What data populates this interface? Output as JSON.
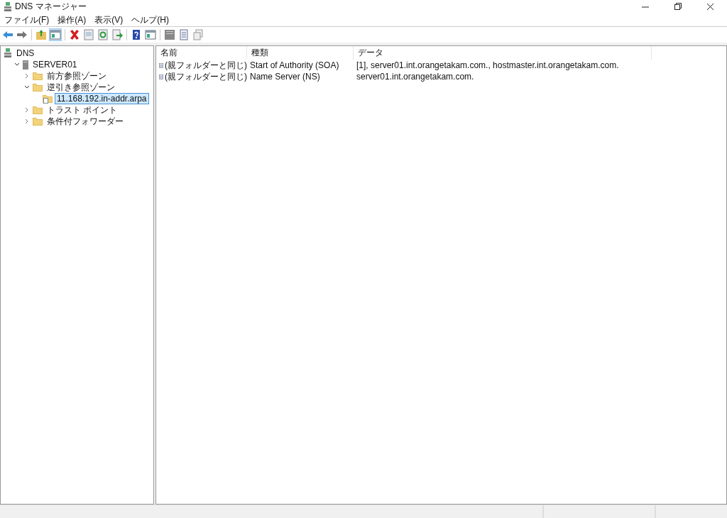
{
  "window": {
    "title": "DNS マネージャー"
  },
  "menu": [
    "ファイル(F)",
    "操作(A)",
    "表示(V)",
    "ヘルプ(H)"
  ],
  "toolbar": [
    [
      {
        "kind": "back",
        "pressed": false
      },
      {
        "kind": "forward",
        "pressed": false
      }
    ],
    [
      {
        "kind": "folder-up",
        "pressed": false
      },
      {
        "kind": "pane",
        "pressed": true
      }
    ],
    [
      {
        "kind": "delete",
        "pressed": false
      },
      {
        "kind": "properties",
        "pressed": false
      },
      {
        "kind": "refresh",
        "pressed": false
      },
      {
        "kind": "export",
        "pressed": false
      }
    ],
    [
      {
        "kind": "help",
        "pressed": false
      },
      {
        "kind": "pane",
        "pressed": false
      }
    ],
    [
      {
        "kind": "server",
        "pressed": false
      },
      {
        "kind": "list",
        "pressed": false
      },
      {
        "kind": "copy",
        "pressed": false
      }
    ]
  ],
  "tree": [
    {
      "label": "DNS",
      "kind": "dns",
      "selected": false,
      "children": [
        {
          "label": "SERVER01",
          "kind": "server",
          "selected": false,
          "expanded": true,
          "children": [
            {
              "label": "前方参照ゾーン",
              "kind": "folder",
              "selected": false,
              "expanded": false
            },
            {
              "label": "逆引き参照ゾーン",
              "kind": "folder",
              "selected": false,
              "expanded": true,
              "children": [
                {
                  "label": "11.168.192.in-addr.arpa",
                  "kind": "zone",
                  "selected": true
                }
              ]
            },
            {
              "label": "トラスト ポイント",
              "kind": "folder",
              "selected": false,
              "expanded": false
            },
            {
              "label": "条件付フォワーダー",
              "kind": "folder",
              "selected": false,
              "expanded": false
            }
          ]
        }
      ]
    }
  ],
  "table": {
    "columns": [
      "名前",
      "種類",
      "データ"
    ],
    "rows": [
      [
        "(親フォルダーと同じ)",
        "Start of Authority (SOA)",
        "[1], server01.int.orangetakam.com., hostmaster.int.orangetakam.com."
      ],
      [
        "(親フォルダーと同じ)",
        "Name Server (NS)",
        "server01.int.orangetakam.com."
      ]
    ]
  }
}
